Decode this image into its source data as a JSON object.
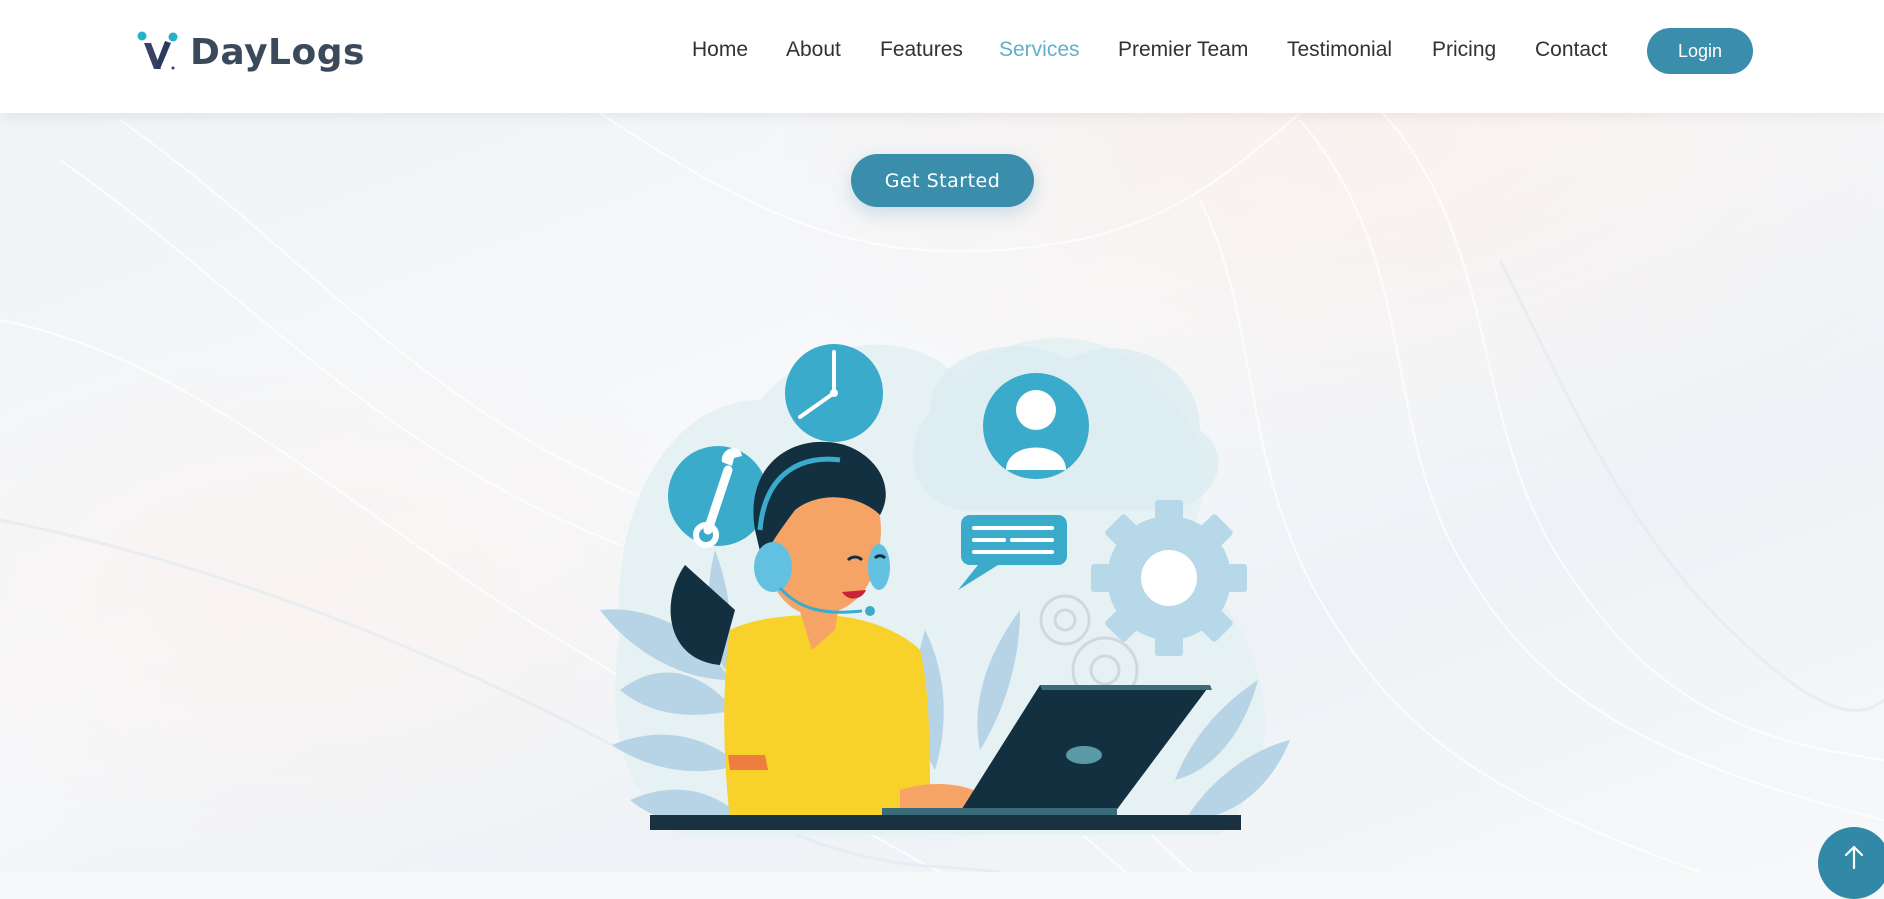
{
  "brand": {
    "name": "DayLogs",
    "logo_icon": "daylogs-logo-mark"
  },
  "nav": {
    "items": [
      {
        "label": "Home",
        "active": false
      },
      {
        "label": "About",
        "active": false
      },
      {
        "label": "Features",
        "active": false
      },
      {
        "label": "Services",
        "active": true
      },
      {
        "label": "Premier Team",
        "active": false
      },
      {
        "label": "Testimonial",
        "active": false
      },
      {
        "label": "Pricing",
        "active": false
      },
      {
        "label": "Contact",
        "active": false
      }
    ],
    "login_label": "Login"
  },
  "hero": {
    "cta_label": "Get Started",
    "illustration": "customer-support-agent-illustration"
  },
  "scroll_top": {
    "icon": "arrow-up-icon"
  },
  "colors": {
    "accent": "#3a8eac",
    "active_nav": "#5fb1cb",
    "text": "#2e3338",
    "brand_text": "#3b4a5a",
    "illustration_blue": "#3aabcb",
    "illustration_yellow": "#f8d12a",
    "illustration_dark": "#12303f"
  }
}
